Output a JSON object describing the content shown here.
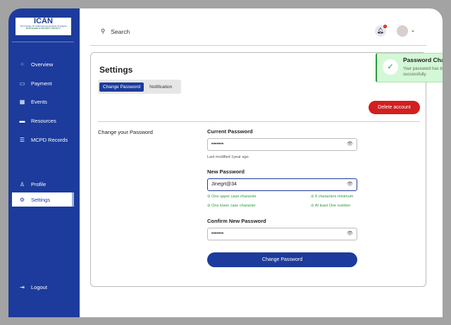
{
  "logo": {
    "title": "ICAN",
    "line1": "The Institute Of Chartered Accountants Of Nigeria",
    "line2": "BURUGANE & DISTRICT SOCIETY"
  },
  "sidebar": {
    "items": [
      {
        "label": "Overview",
        "icon": "grid-icon"
      },
      {
        "label": "Payment",
        "icon": "card-icon"
      },
      {
        "label": "Events",
        "icon": "calendar-icon"
      },
      {
        "label": "Resources",
        "icon": "folder-icon"
      },
      {
        "label": "MCPD Records",
        "icon": "list-icon"
      },
      {
        "label": "Profile",
        "icon": "user-icon"
      },
      {
        "label": "Settings",
        "icon": "gear-icon",
        "active": true
      }
    ],
    "logout": "Logout"
  },
  "header": {
    "search_placeholder": "Search",
    "notification_count": "1"
  },
  "settings": {
    "title": "Settings",
    "tabs": [
      "Change Password",
      "Notification"
    ],
    "active_tab": "Change Password",
    "delete_label": "Delete account",
    "section": "Change your Password",
    "current_label": "Current Password",
    "current_value": "•••••••",
    "last_modified": "Last modified 1year ago",
    "new_label": "New Password",
    "new_value": "Jinegrt@34",
    "rules": [
      "One upper case character",
      "8 characters minimum",
      "One lower case character",
      "At least One number"
    ],
    "confirm_label": "Confirm New Password",
    "confirm_value": "•••••••",
    "submit_label": "Change Password"
  },
  "toast": {
    "title": "Password Changed",
    "message": "Your password has been changed successfully."
  },
  "colors": {
    "primary": "#1c3b9c",
    "danger": "#d21f1f",
    "success": "#2a9a3a"
  }
}
